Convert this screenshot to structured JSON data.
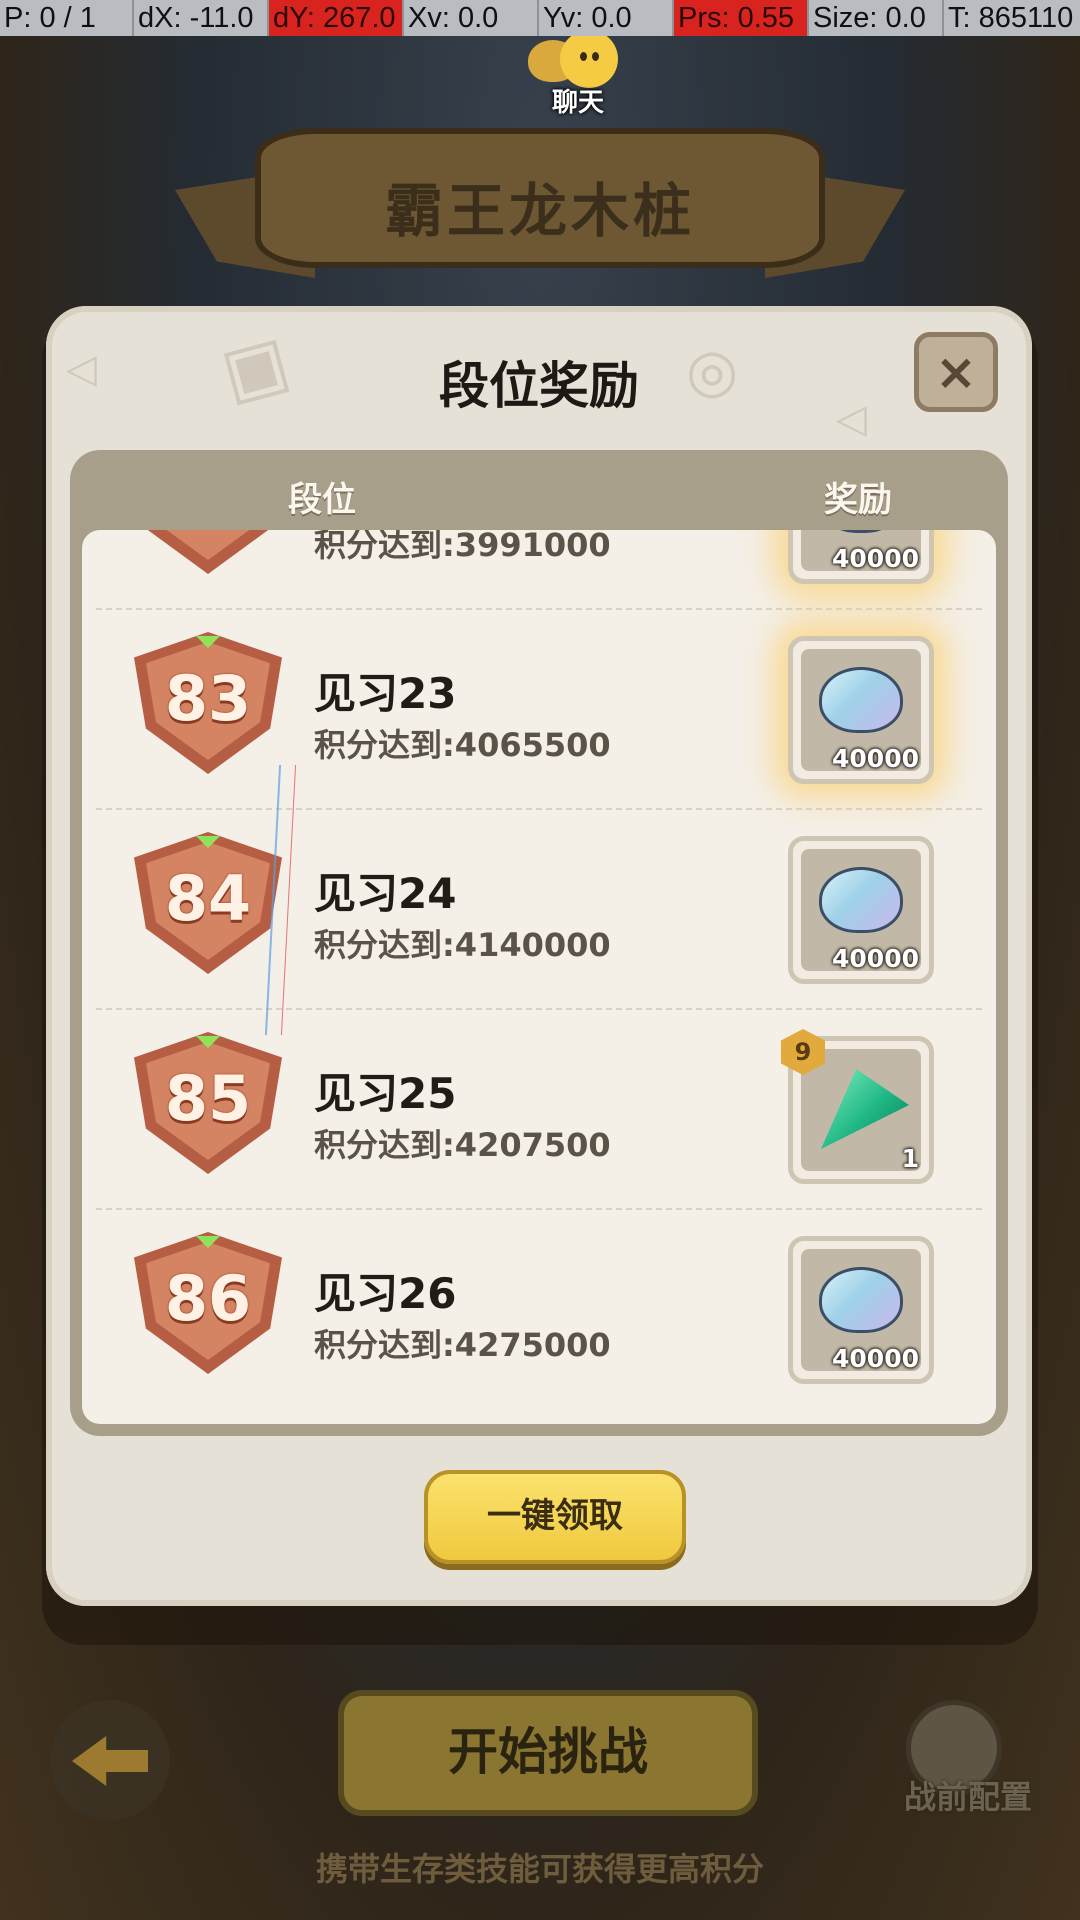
{
  "debug": {
    "p": "P: 0 / 1",
    "dx": "dX: -11.0",
    "dy": "dY: 267.0",
    "xv": "Xv: 0.0",
    "yv": "Yv: 0.0",
    "prs": "Prs: 0.55",
    "size": "Size: 0.0",
    "t": "T: 865110"
  },
  "chat": {
    "label": "聊天"
  },
  "title_banner": "霸王龙木桩",
  "dialog": {
    "title": "段位奖励",
    "close_label": "×",
    "col_rank": "段位",
    "col_reward": "奖励",
    "partial_row": {
      "score": "积分达到:3991000",
      "reward_qty": "40000"
    },
    "rows": [
      {
        "badge": "83",
        "name": "见习23",
        "score": "积分达到:4065500",
        "reward_type": "shell",
        "reward_qty": "40000"
      },
      {
        "badge": "84",
        "name": "见习24",
        "score": "积分达到:4140000",
        "reward_type": "shell",
        "reward_qty": "40000"
      },
      {
        "badge": "85",
        "name": "见习25",
        "score": "积分达到:4207500",
        "reward_type": "crystal",
        "reward_qty": "1",
        "reward_level": "9"
      },
      {
        "badge": "86",
        "name": "见习26",
        "score": "积分达到:4275000",
        "reward_type": "shell",
        "reward_qty": "40000"
      }
    ],
    "claim_all": "一键领取"
  },
  "bottom": {
    "start": "开始挑战",
    "prep": "战前配置",
    "hint": "携带生存类技能可获得更高积分"
  },
  "colors": {
    "badge_bronze": "#b65e43",
    "claim_button": "#f0c93e",
    "debug_alert": "#d8231f"
  },
  "icons": [
    "chat-icon",
    "close-icon",
    "shell-icon",
    "crystal-icon",
    "back-arrow-icon",
    "character-avatar-icon"
  ]
}
